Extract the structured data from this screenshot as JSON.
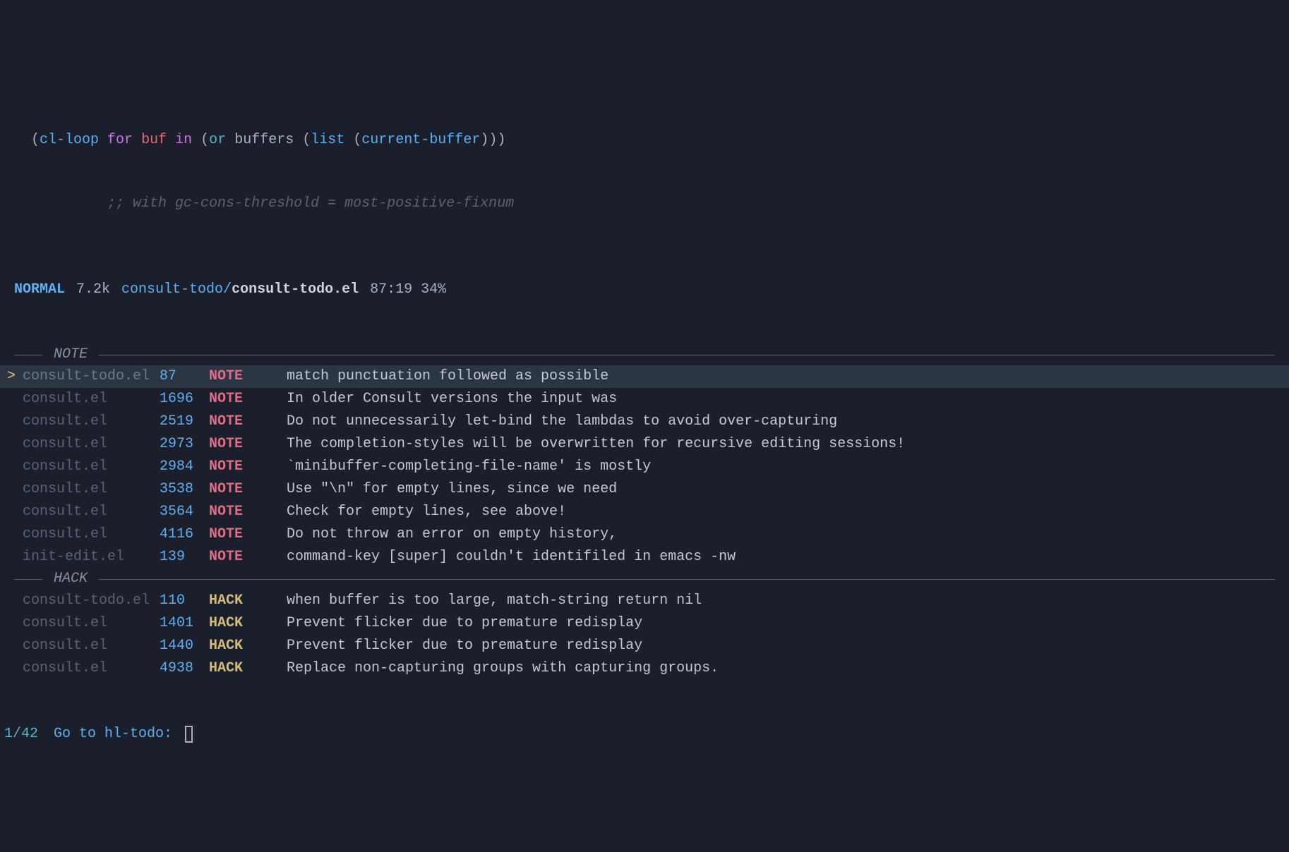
{
  "code": {
    "line1_tokens": [
      "(",
      "cl-loop",
      " ",
      "for",
      " ",
      "buf",
      " ",
      "in",
      " ",
      "(",
      "or",
      " ",
      "buffers",
      " ",
      "(",
      "list",
      " ",
      "(",
      "current-buffer",
      ")",
      ")",
      ")"
    ],
    "line2_indent": "           ",
    "line2_comment": ";; with gc-cons-threshold = most-positive-fixnum"
  },
  "modeline": {
    "mode": "NORMAL",
    "size": "7.2k",
    "path": "consult-todo/",
    "file": "consult-todo.el",
    "position": "87:19 34%"
  },
  "groups": [
    {
      "title": "NOTE",
      "tag_class": "tag-note",
      "rows": [
        {
          "selected": true,
          "marker": ">",
          "file": "consult-todo.el",
          "line": "87",
          "tag": "NOTE",
          "desc": "match punctuation followed as possible"
        },
        {
          "selected": false,
          "marker": "",
          "file": "consult.el",
          "line": "1696",
          "tag": "NOTE",
          "desc": "In older Consult versions the input was"
        },
        {
          "selected": false,
          "marker": "",
          "file": "consult.el",
          "line": "2519",
          "tag": "NOTE",
          "desc": "Do not unnecessarily let-bind the lambdas to avoid over-capturing"
        },
        {
          "selected": false,
          "marker": "",
          "file": "consult.el",
          "line": "2973",
          "tag": "NOTE",
          "desc": "The completion-styles will be overwritten for recursive editing sessions!"
        },
        {
          "selected": false,
          "marker": "",
          "file": "consult.el",
          "line": "2984",
          "tag": "NOTE",
          "desc": "`minibuffer-completing-file-name' is mostly"
        },
        {
          "selected": false,
          "marker": "",
          "file": "consult.el",
          "line": "3538",
          "tag": "NOTE",
          "desc": "Use \"\\n\" for empty lines, since we need"
        },
        {
          "selected": false,
          "marker": "",
          "file": "consult.el",
          "line": "3564",
          "tag": "NOTE",
          "desc": "Check for empty lines, see above!"
        },
        {
          "selected": false,
          "marker": "",
          "file": "consult.el",
          "line": "4116",
          "tag": "NOTE",
          "desc": "Do not throw an error on empty history,"
        },
        {
          "selected": false,
          "marker": "",
          "file": "init-edit.el",
          "line": "139",
          "tag": "NOTE",
          "desc": "command-key [super] couldn't identifiled in emacs -nw"
        }
      ]
    },
    {
      "title": "HACK",
      "tag_class": "tag-hack",
      "rows": [
        {
          "selected": false,
          "marker": "",
          "file": "consult-todo.el",
          "line": "110",
          "tag": "HACK",
          "desc": "when buffer is too large, match-string return nil"
        },
        {
          "selected": false,
          "marker": "",
          "file": "consult.el",
          "line": "1401",
          "tag": "HACK",
          "desc": "Prevent flicker due to premature redisplay"
        },
        {
          "selected": false,
          "marker": "",
          "file": "consult.el",
          "line": "1440",
          "tag": "HACK",
          "desc": "Prevent flicker due to premature redisplay"
        },
        {
          "selected": false,
          "marker": "",
          "file": "consult.el",
          "line": "4938",
          "tag": "HACK",
          "desc": "Replace non-capturing groups with capturing groups."
        }
      ]
    }
  ],
  "prompt": {
    "count": "1/42",
    "label": "Go to hl-todo: "
  }
}
